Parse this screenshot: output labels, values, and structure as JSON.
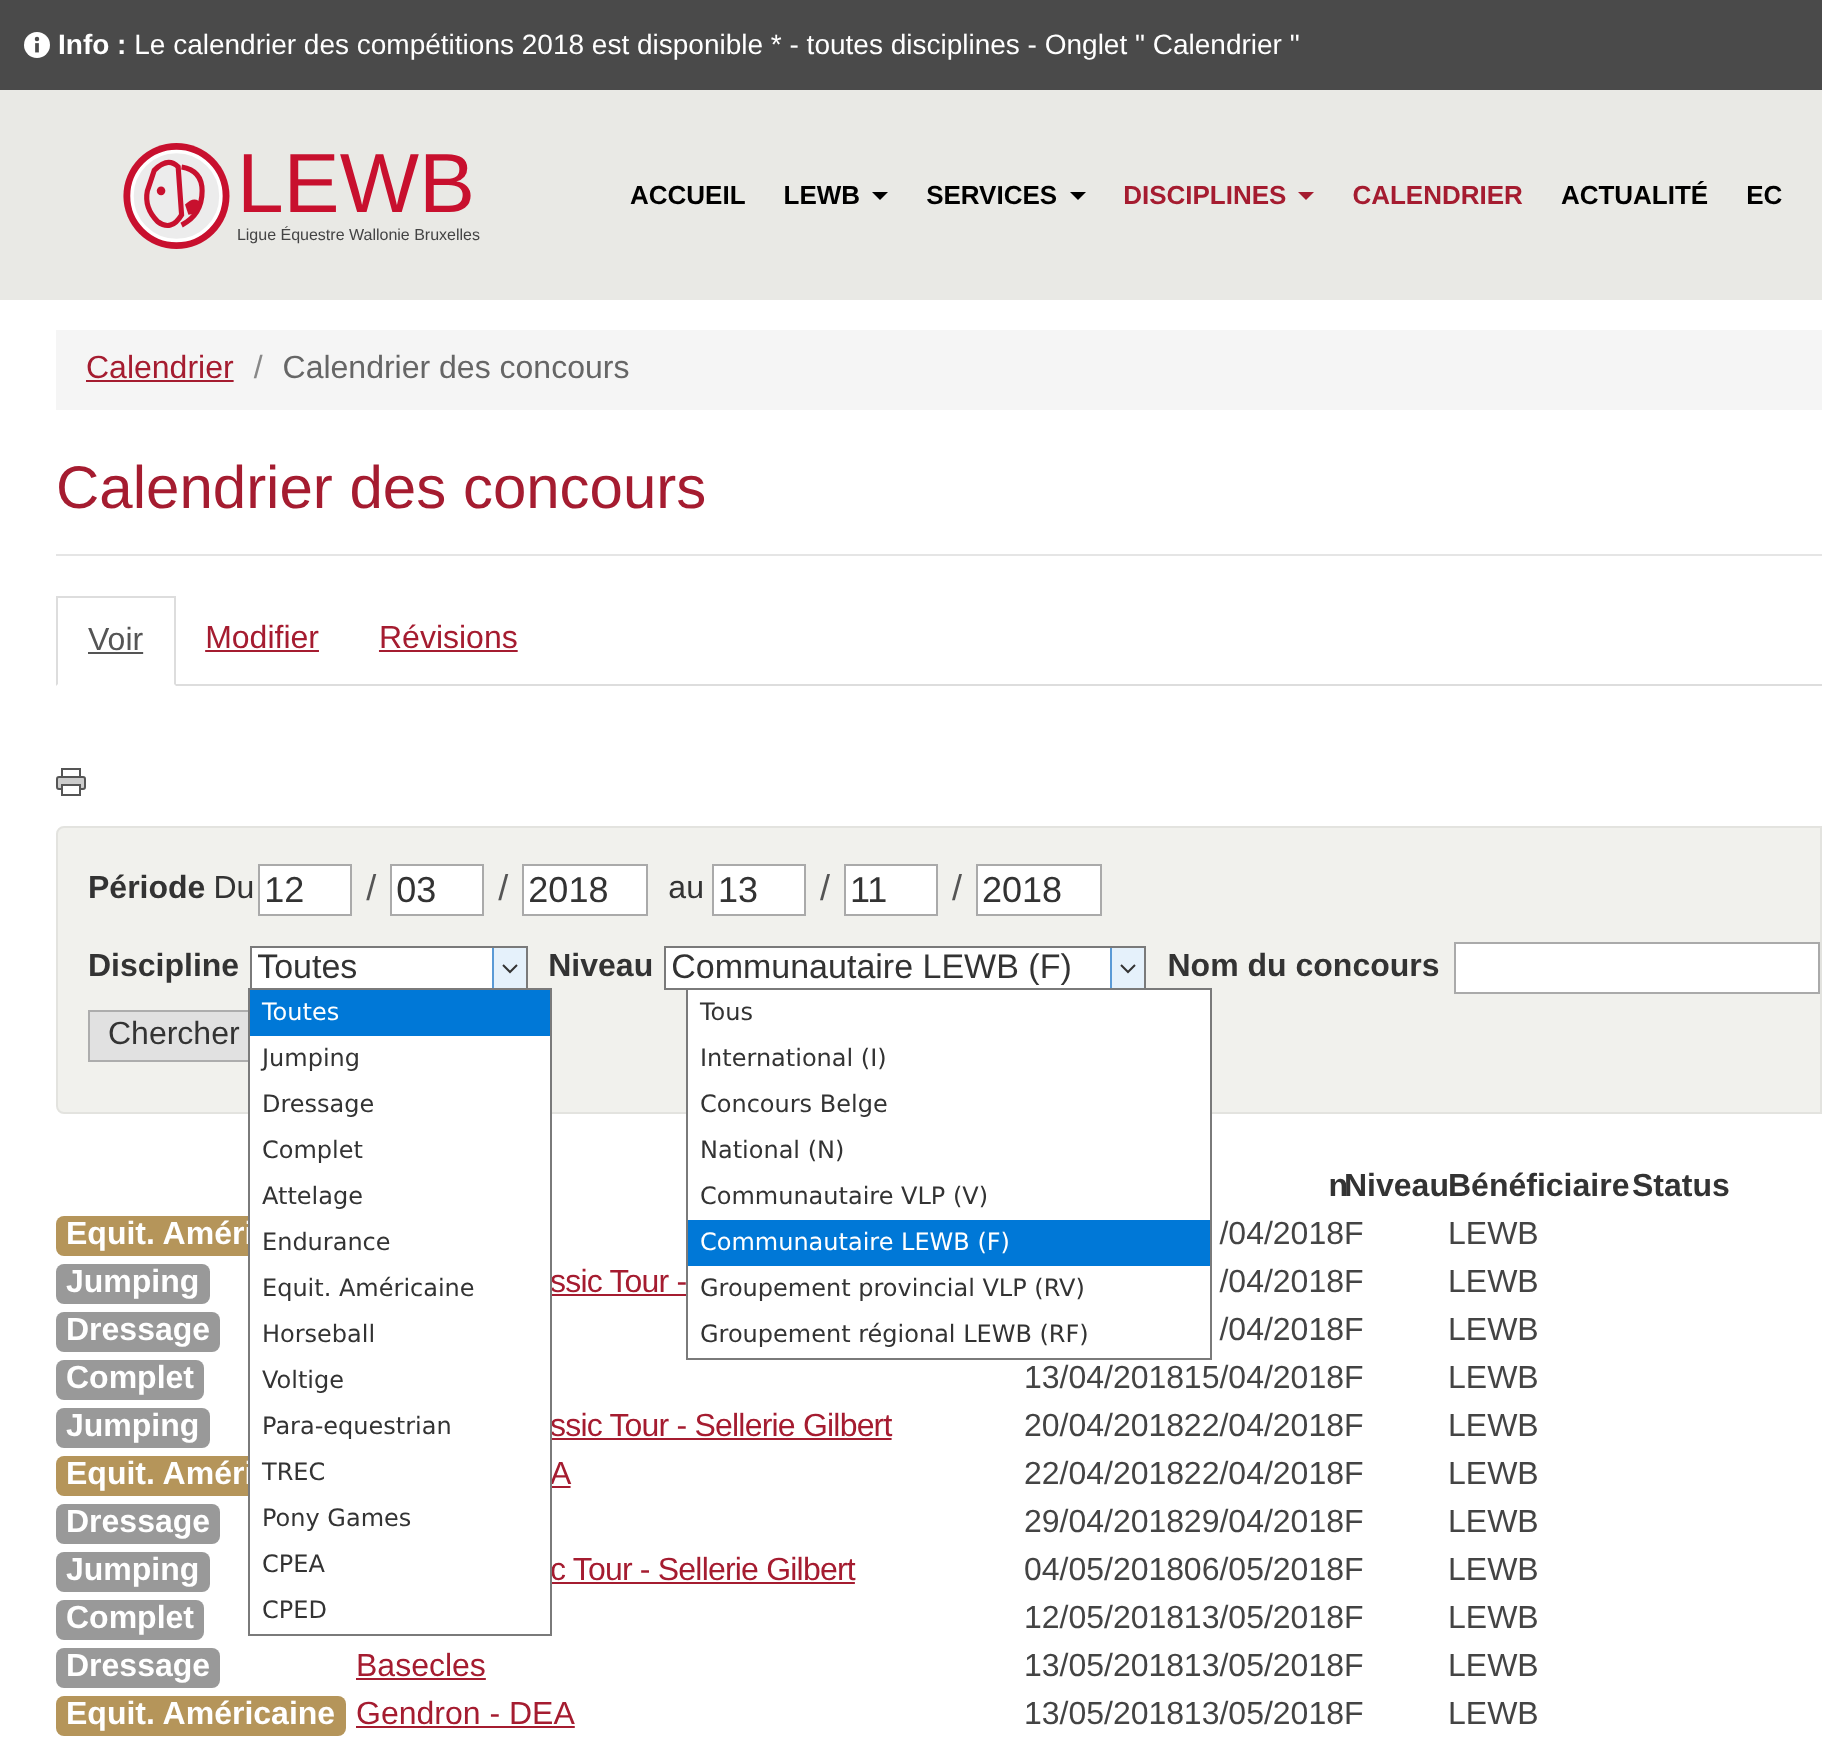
{
  "info_bar": {
    "label": "Info :",
    "text": "Le calendrier des compétitions 2018 est disponible * - toutes disciplines - Onglet \" Calendrier \""
  },
  "logo": {
    "name": "LEWB",
    "tagline": "Ligue Équestre Wallonie Bruxelles"
  },
  "nav": [
    {
      "label": "ACCUEIL",
      "caret": false,
      "highlighted": false
    },
    {
      "label": "LEWB",
      "caret": true,
      "highlighted": false
    },
    {
      "label": "SERVICES",
      "caret": true,
      "highlighted": false
    },
    {
      "label": "DISCIPLINES",
      "caret": true,
      "highlighted": true
    },
    {
      "label": "CALENDRIER",
      "caret": false,
      "highlighted": true
    },
    {
      "label": "ACTUALITÉ",
      "caret": false,
      "highlighted": false
    },
    {
      "label": "EC",
      "caret": false,
      "highlighted": false
    }
  ],
  "breadcrumb_separator": "/",
  "breadcrumb": [
    {
      "label": "Calendrier",
      "link": true
    },
    {
      "label": "Calendrier des concours",
      "link": false
    }
  ],
  "page_title": "Calendrier des concours",
  "tabs": [
    {
      "label": "Voir",
      "selected": true
    },
    {
      "label": "Modifier",
      "selected": false
    },
    {
      "label": "Révisions",
      "selected": false
    }
  ],
  "filter": {
    "period_label": "Période",
    "from_label": "Du",
    "to_label": "au",
    "separator": "/",
    "from": [
      "12",
      "03",
      "2018"
    ],
    "to": [
      "13",
      "11",
      "2018"
    ],
    "discipline_label": "Discipline",
    "discipline_value": "Toutes",
    "level_label": "Niveau",
    "level_value": "Communautaire LEWB (F)",
    "name_label": "Nom du concours",
    "search_button": "Chercher"
  },
  "discipline_options": [
    {
      "label": "Toutes",
      "selected": true
    },
    {
      "label": "Jumping",
      "selected": false
    },
    {
      "label": "Dressage",
      "selected": false
    },
    {
      "label": "Complet",
      "selected": false
    },
    {
      "label": "Attelage",
      "selected": false
    },
    {
      "label": "Endurance",
      "selected": false
    },
    {
      "label": "Equit. Américaine",
      "selected": false
    },
    {
      "label": "Horseball",
      "selected": false
    },
    {
      "label": "Voltige",
      "selected": false
    },
    {
      "label": "Para-equestrian",
      "selected": false
    },
    {
      "label": "TREC",
      "selected": false
    },
    {
      "label": "Pony Games",
      "selected": false
    },
    {
      "label": "CPEA",
      "selected": false
    },
    {
      "label": "CPED",
      "selected": false
    }
  ],
  "level_options": [
    {
      "label": "Tous",
      "selected": false
    },
    {
      "label": "International (I)",
      "selected": false
    },
    {
      "label": "Concours Belge",
      "selected": false
    },
    {
      "label": "National (N)",
      "selected": false
    },
    {
      "label": "Communautaire VLP (V)",
      "selected": false
    },
    {
      "label": "Communautaire LEWB (F)",
      "selected": true
    },
    {
      "label": "Groupement provincial VLP (RV)",
      "selected": false
    },
    {
      "label": "Groupement régional LEWB (RF)",
      "selected": false
    }
  ],
  "table": {
    "columns": [
      "n",
      "Niveau",
      "Bénéficiaire",
      "Status"
    ],
    "rows": [
      {
        "discipline": "Equit. Améri",
        "color": "#b5955a",
        "name": "",
        "start": "",
        "end": "/04/2018",
        "level": "F",
        "beneficiary": "LEWB"
      },
      {
        "discipline": "Jumping",
        "color": "#999999",
        "name": "ssic Tour -",
        "name_covered": true,
        "start": "",
        "end": "/04/2018",
        "level": "F",
        "beneficiary": "LEWB"
      },
      {
        "discipline": "Dressage",
        "color": "#999999",
        "name": "",
        "start": "",
        "end": "/04/2018",
        "level": "F",
        "beneficiary": "LEWB"
      },
      {
        "discipline": "Complet",
        "color": "#999999",
        "name": "",
        "start": "13/04/2018",
        "end": "15/04/2018",
        "level": "F",
        "beneficiary": "LEWB"
      },
      {
        "discipline": "Jumping",
        "color": "#999999",
        "name": "ssic Tour - Sellerie Gilbert",
        "name_covered": true,
        "start": "20/04/2018",
        "end": "22/04/2018",
        "level": "F",
        "beneficiary": "LEWB"
      },
      {
        "discipline": "Equit. Améri",
        "color": "#b5955a",
        "name": "A",
        "name_covered": true,
        "start": "22/04/2018",
        "end": "22/04/2018",
        "level": "F",
        "beneficiary": "LEWB"
      },
      {
        "discipline": "Dressage",
        "color": "#999999",
        "name": "",
        "start": "29/04/2018",
        "end": "29/04/2018",
        "level": "F",
        "beneficiary": "LEWB"
      },
      {
        "discipline": "Jumping",
        "color": "#999999",
        "name": "c Tour - Sellerie Gilbert",
        "name_covered": true,
        "start": "04/05/2018",
        "end": "06/05/2018",
        "level": "F",
        "beneficiary": "LEWB"
      },
      {
        "discipline": "Complet",
        "color": "#999999",
        "name": "",
        "start": "12/05/2018",
        "end": "13/05/2018",
        "level": "F",
        "beneficiary": "LEWB"
      },
      {
        "discipline": "Dressage",
        "color": "#999999",
        "name": "Basecles",
        "name_covered": false,
        "start": "13/05/2018",
        "end": "13/05/2018",
        "level": "F",
        "beneficiary": "LEWB"
      },
      {
        "discipline": "Equit. Américaine",
        "color": "#b5955a",
        "name": "Gendron - DEA",
        "name_covered": false,
        "start": "13/05/2018",
        "end": "13/05/2018",
        "level": "F",
        "beneficiary": "LEWB"
      }
    ]
  }
}
